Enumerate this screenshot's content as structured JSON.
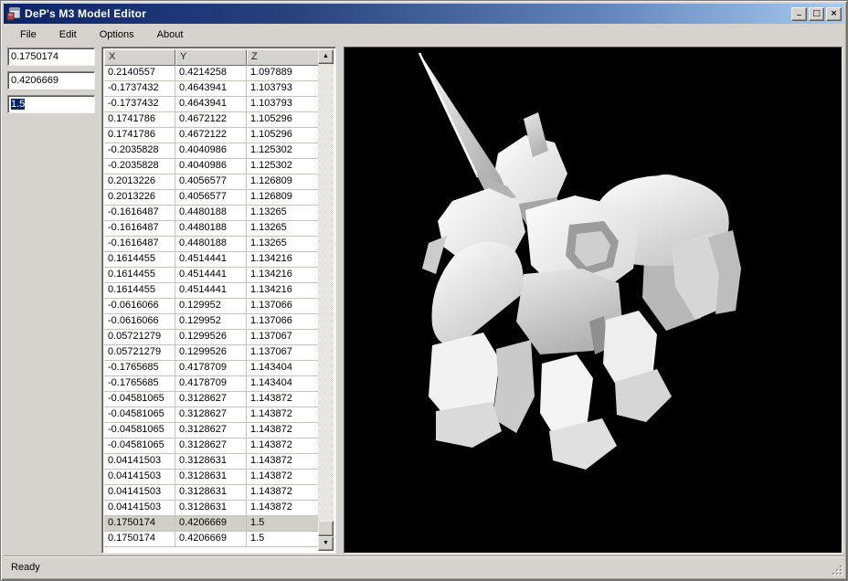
{
  "window": {
    "title": "DeP's M3 Model Editor",
    "status": "Ready"
  },
  "icons": {
    "app_icon": "winforms-app-icon",
    "minimize_glyph": "_",
    "maximize_glyph": "□",
    "close_glyph": "×",
    "scroll_up_glyph": "▲",
    "scroll_down_glyph": "▼"
  },
  "menu": {
    "items": [
      "File",
      "Edit",
      "Options",
      "About"
    ]
  },
  "inputs": {
    "x": "0.1750174",
    "y": "0.4206669",
    "z": "1.5",
    "z_selected": true
  },
  "grid": {
    "columns": [
      "X",
      "Y",
      "Z"
    ],
    "selected_row_index": 29,
    "rows": [
      [
        "0.2140557",
        "0.4214258",
        "1.097889"
      ],
      [
        "-0.1737432",
        "0.4643941",
        "1.103793"
      ],
      [
        "-0.1737432",
        "0.4643941",
        "1.103793"
      ],
      [
        "0.1741786",
        "0.4672122",
        "1.105296"
      ],
      [
        "0.1741786",
        "0.4672122",
        "1.105296"
      ],
      [
        "-0.2035828",
        "0.4040986",
        "1.125302"
      ],
      [
        "-0.2035828",
        "0.4040986",
        "1.125302"
      ],
      [
        "0.2013226",
        "0.4056577",
        "1.126809"
      ],
      [
        "0.2013226",
        "0.4056577",
        "1.126809"
      ],
      [
        "-0.1616487",
        "0.4480188",
        "1.13265"
      ],
      [
        "-0.1616487",
        "0.4480188",
        "1.13265"
      ],
      [
        "-0.1616487",
        "0.4480188",
        "1.13265"
      ],
      [
        "0.1614455",
        "0.4514441",
        "1.134216"
      ],
      [
        "0.1614455",
        "0.4514441",
        "1.134216"
      ],
      [
        "0.1614455",
        "0.4514441",
        "1.134216"
      ],
      [
        "-0.0616066",
        "0.129952",
        "1.137066"
      ],
      [
        "-0.0616066",
        "0.129952",
        "1.137066"
      ],
      [
        "0.05721279",
        "0.1299526",
        "1.137067"
      ],
      [
        "0.05721279",
        "0.1299526",
        "1.137067"
      ],
      [
        "-0.1765685",
        "0.4178709",
        "1.143404"
      ],
      [
        "-0.1765685",
        "0.4178709",
        "1.143404"
      ],
      [
        "-0.04581065",
        "0.3128627",
        "1.143872"
      ],
      [
        "-0.04581065",
        "0.3128627",
        "1.143872"
      ],
      [
        "-0.04581065",
        "0.3128627",
        "1.143872"
      ],
      [
        "-0.04581065",
        "0.3128627",
        "1.143872"
      ],
      [
        "0.04141503",
        "0.3128631",
        "1.143872"
      ],
      [
        "0.04141503",
        "0.3128631",
        "1.143872"
      ],
      [
        "0.04141503",
        "0.3128631",
        "1.143872"
      ],
      [
        "0.04141503",
        "0.3128631",
        "1.143872"
      ],
      [
        "0.1750174",
        "0.4206669",
        "1.5"
      ],
      [
        "0.1750174",
        "0.4206669",
        "1.5"
      ]
    ]
  },
  "viewport": {
    "background": "#000000",
    "content": "white low-poly 3D mech model",
    "model_color": "#f2f2f2"
  },
  "colors": {
    "chrome": "#d6d3ce",
    "titlebar_left": "#0b246a",
    "titlebar_right": "#a6caf0",
    "selection": "#0a246a",
    "selected_row": "#d2cfc8"
  }
}
